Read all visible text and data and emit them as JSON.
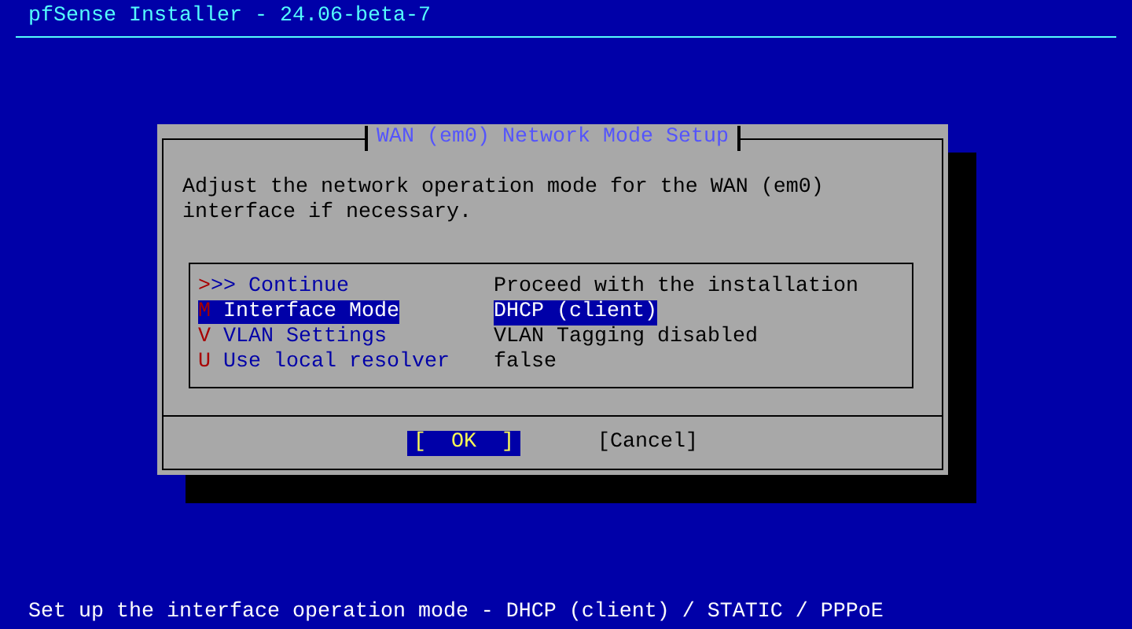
{
  "header": {
    "title": "pfSense Installer - 24.06-beta-7"
  },
  "dialog": {
    "title": "WAN (em0) Network Mode Setup",
    "description": "Adjust the network operation mode for the WAN (em0) interface if necessary.",
    "menu": [
      {
        "label": ">>> Continue",
        "value": "Proceed with the installation",
        "selected": false
      },
      {
        "label": "M Interface Mode",
        "value": "DHCP (client)",
        "selected": true
      },
      {
        "label": "V VLAN Settings",
        "value": "VLAN Tagging disabled",
        "selected": false
      },
      {
        "label": "U Use local resolver",
        "value": "false",
        "selected": false
      }
    ],
    "buttons": [
      {
        "label": "[  OK  ]",
        "selected": true
      },
      {
        "label": "[Cancel]",
        "selected": false
      }
    ]
  },
  "status_bar": "Set up the interface operation mode - DHCP (client) / STATIC / PPPoE"
}
